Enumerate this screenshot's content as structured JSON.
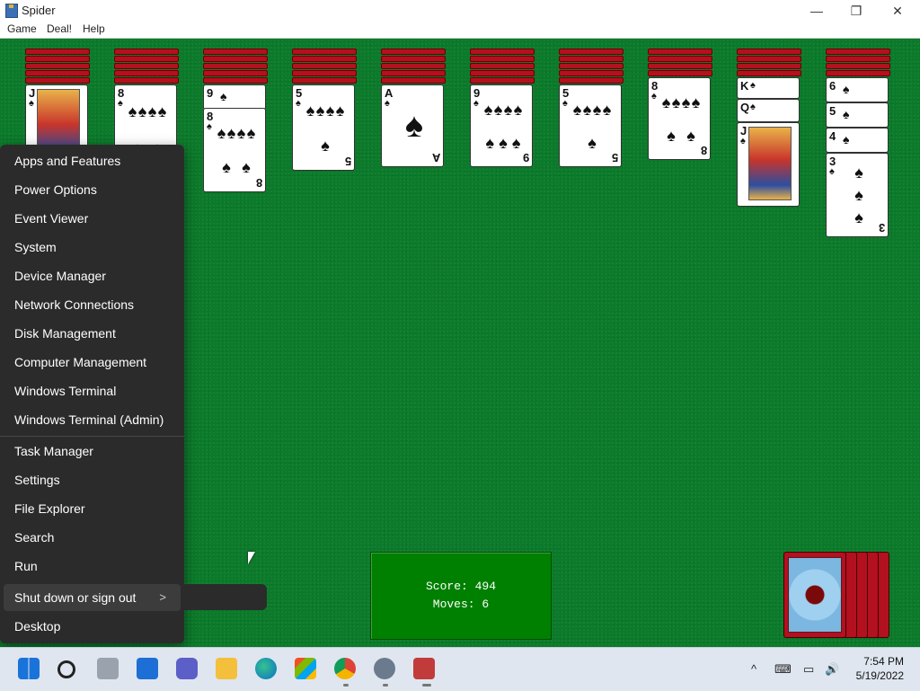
{
  "window": {
    "title": "Spider",
    "controls": [
      "—",
      "❐",
      "✕"
    ]
  },
  "menubar": {
    "items": [
      "Game",
      "Deal!",
      "Help"
    ]
  },
  "tableau": [
    {
      "faceup": [
        {
          "rank": "J",
          "suit": "♠",
          "face": true
        }
      ]
    },
    {
      "faceup": [
        {
          "rank": "8",
          "suit": "♠"
        }
      ]
    },
    {
      "faceup": [
        {
          "rank": "9",
          "suit": "♠"
        },
        {
          "rank": "8",
          "suit": "♠"
        }
      ]
    },
    {
      "faceup": [
        {
          "rank": "5",
          "suit": "♠"
        }
      ]
    },
    {
      "faceup": [
        {
          "rank": "A",
          "suit": "♠"
        }
      ]
    },
    {
      "faceup": [
        {
          "rank": "9",
          "suit": "♠"
        }
      ]
    },
    {
      "faceup": [
        {
          "rank": "5",
          "suit": "♠"
        }
      ]
    },
    {
      "faceup": [
        {
          "rank": "8",
          "suit": "♠"
        }
      ]
    },
    {
      "faceup": [
        {
          "rank": "K",
          "suit": "♠",
          "face": true
        },
        {
          "rank": "Q",
          "suit": "♠",
          "face": true
        },
        {
          "rank": "J",
          "suit": "♠",
          "face": true
        }
      ]
    },
    {
      "faceup": [
        {
          "rank": "6",
          "suit": "♠"
        },
        {
          "rank": "5",
          "suit": "♠"
        },
        {
          "rank": "4",
          "suit": "♠"
        },
        {
          "rank": "3",
          "suit": "♠"
        }
      ]
    }
  ],
  "context_menu": {
    "items": [
      "Apps and Features",
      "Power Options",
      "Event Viewer",
      "System",
      "Device Manager",
      "Network Connections",
      "Disk Management",
      "Computer Management",
      "Windows Terminal",
      "Windows Terminal (Admin)",
      "Task Manager",
      "Settings",
      "File Explorer",
      "Search",
      "Run",
      "Shut down or sign out",
      "Desktop"
    ],
    "submenu_chevron": ">"
  },
  "score": {
    "score_label": "Score:",
    "score_value": "494",
    "moves_label": "Moves:",
    "moves_value": "6"
  },
  "taskbar": {
    "apps": [
      "start-icon",
      "search-icon",
      "task-view-icon",
      "widgets-icon",
      "teams-icon",
      "file-explorer-icon",
      "edge-icon",
      "store-icon",
      "chrome-icon",
      "settings-icon",
      "spider-icon"
    ],
    "tray": {
      "chevron": "^",
      "keyboard": "⌨",
      "network": "▭",
      "volume": "🔊"
    },
    "time": "7:54 PM",
    "date": "5/19/2022"
  },
  "colors": {
    "felt": "#0b7a2a",
    "card_back": "#b31020",
    "menu_bg": "#2b2b2b",
    "score_bg": "#008000"
  }
}
